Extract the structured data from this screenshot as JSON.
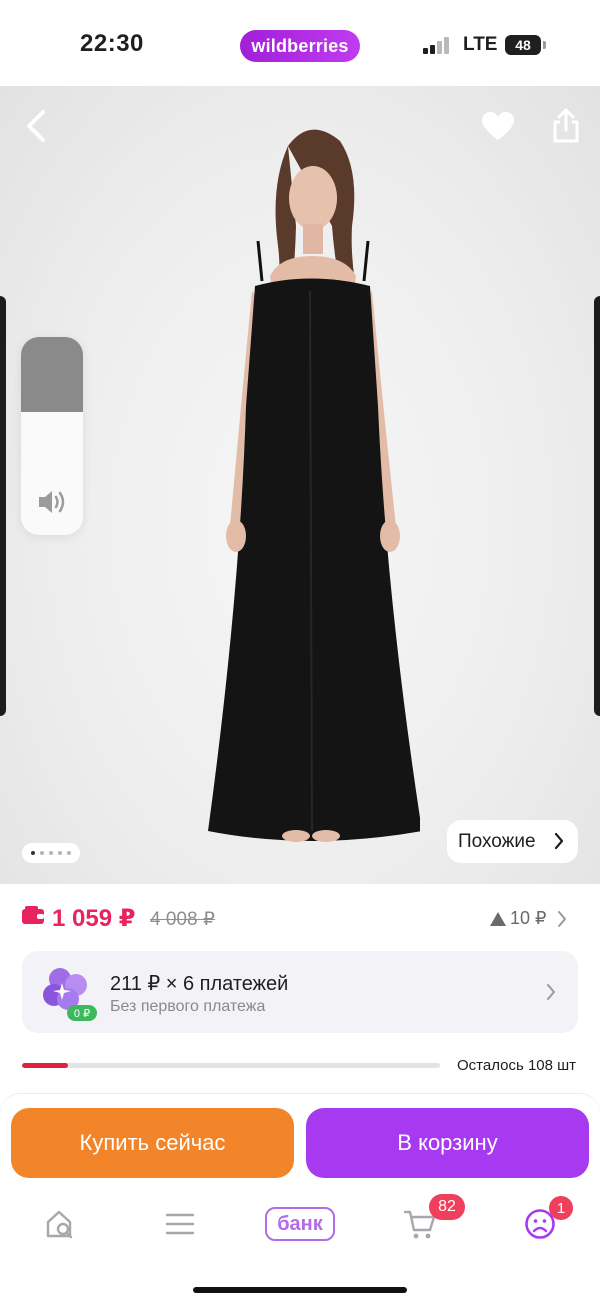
{
  "status_bar": {
    "time": "22:30",
    "brand": "wildberries",
    "network": "LTE",
    "battery": "48"
  },
  "gallery": {
    "similar_label": "Похожие",
    "dots_total": 5,
    "dots_active": 1,
    "volume_level": 0.62
  },
  "price": {
    "current": "1 059 ₽",
    "old": "4 008 ₽",
    "delta": "10 ₽"
  },
  "installment": {
    "title": "211 ₽ × 6 платежей",
    "subtitle": "Без первого платежа",
    "badge": "0 ₽"
  },
  "stock": {
    "label": "Осталось 108 шт",
    "fill_fraction": 0.11
  },
  "actions": {
    "buy_now": "Купить сейчас",
    "to_cart": "В корзину"
  },
  "tabbar": {
    "bank_label": "банк",
    "cart_badge": "82",
    "profile_badge": "1"
  },
  "colors": {
    "brand": "#a73af0",
    "price": "#e8235e",
    "buy_now": "#f2852a",
    "badge": "#ef3f5c"
  },
  "icons": [
    "back-icon",
    "heart-icon",
    "share-icon",
    "volume-icon",
    "wallet-icon",
    "chevron-right-icon",
    "home-search-icon",
    "menu-icon",
    "cart-icon",
    "profile-icon"
  ]
}
